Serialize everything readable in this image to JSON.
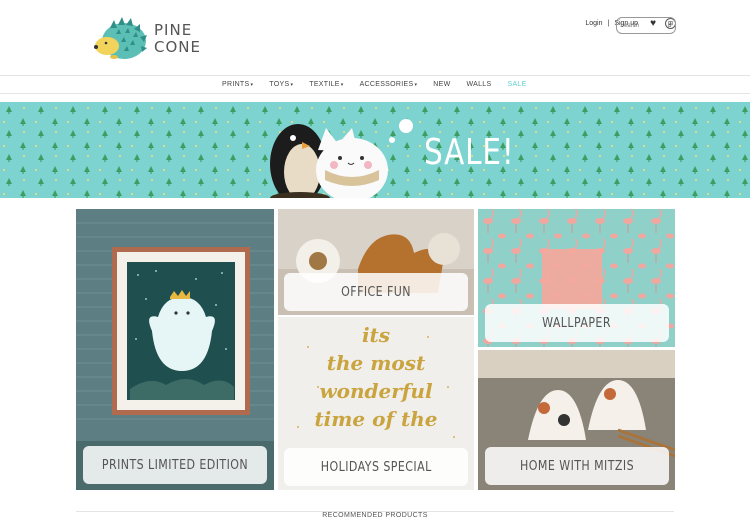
{
  "logo": {
    "line1": "PINE",
    "line2": "CONE"
  },
  "util": {
    "login": "Login",
    "separator": "|",
    "signup": "Sign up"
  },
  "search": {
    "placeholder": "Search"
  },
  "nav": {
    "items": [
      {
        "label": "PRINTS",
        "has_caret": true
      },
      {
        "label": "TOYS",
        "has_caret": true
      },
      {
        "label": "TEXTILE",
        "has_caret": true
      },
      {
        "label": "ACCESSORIES",
        "has_caret": true
      },
      {
        "label": "NEW",
        "has_caret": false
      },
      {
        "label": "WALLS",
        "has_caret": false
      },
      {
        "label": "SALE",
        "has_caret": false
      }
    ],
    "caret": "▾"
  },
  "banner": {
    "text": "SALE!"
  },
  "tiles": {
    "prints": "PRINTS LIMITED EDITION",
    "office": "OFFICE FUN",
    "holidays": "HOLIDAYS SPECIAL",
    "wallpaper": "WALLPAPER",
    "home": "HOME WITH MITZIS",
    "holiday_script": [
      "its",
      "the most",
      "wonderful",
      "time of the"
    ]
  },
  "recommended": "RECOMMENDED PRODUCTS",
  "colors": {
    "accent": "#5ccfcf",
    "banner": "#7dd3cf",
    "wallpaper": "#8fd0c9"
  }
}
